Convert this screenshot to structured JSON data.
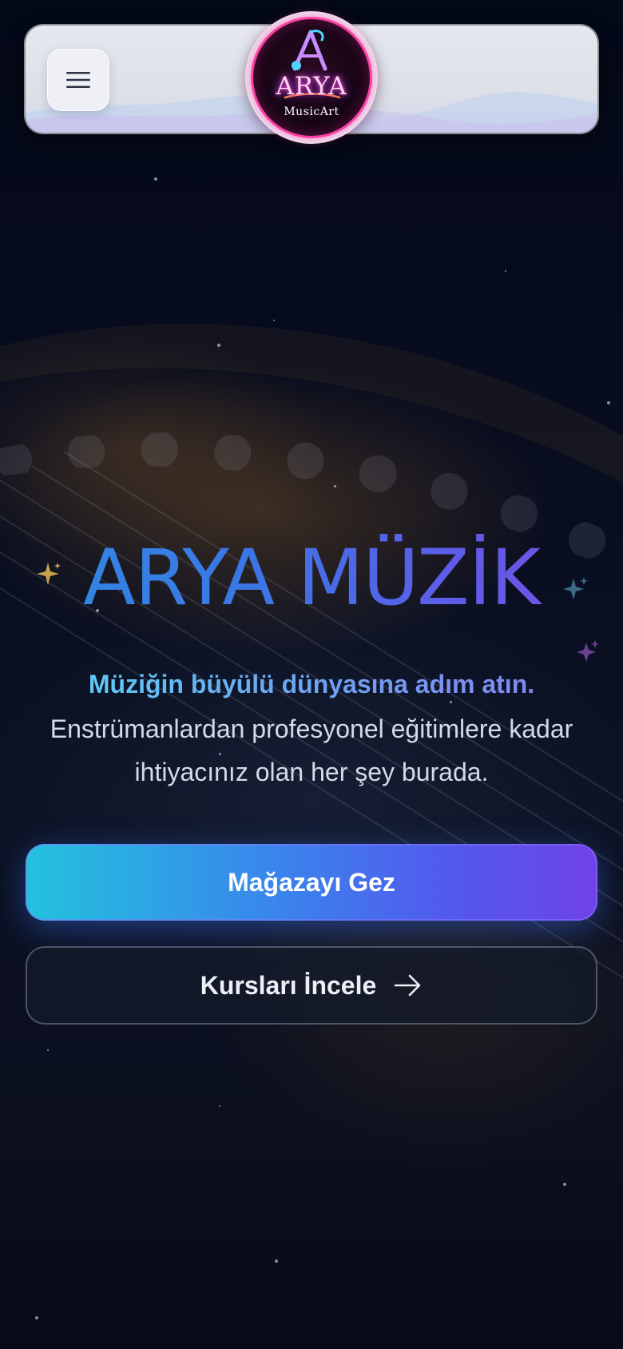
{
  "header": {
    "menu_icon": "hamburger-menu-icon",
    "logo": {
      "wordmark": "ARYA",
      "tagline": "MusicArt",
      "monogram": "A"
    }
  },
  "hero": {
    "title": "ARYA MÜZİK",
    "tagline": "Müziğin büyülü dünyasına adım atın.",
    "description": "Enstrümanlardan profesyonel eğitimlere kadar ihtiyacınız olan her şey burada."
  },
  "actions": {
    "primary_label": "Mağazayı Gez",
    "secondary_label": "Kursları İncele",
    "secondary_icon": "arrow-right-icon"
  },
  "colors": {
    "background": "#050a1c",
    "accent_cyan": "#22c3dd",
    "accent_violet": "#6f42ea",
    "title_blue": "#2f8be0",
    "logo_pink": "#ff3ea5"
  }
}
